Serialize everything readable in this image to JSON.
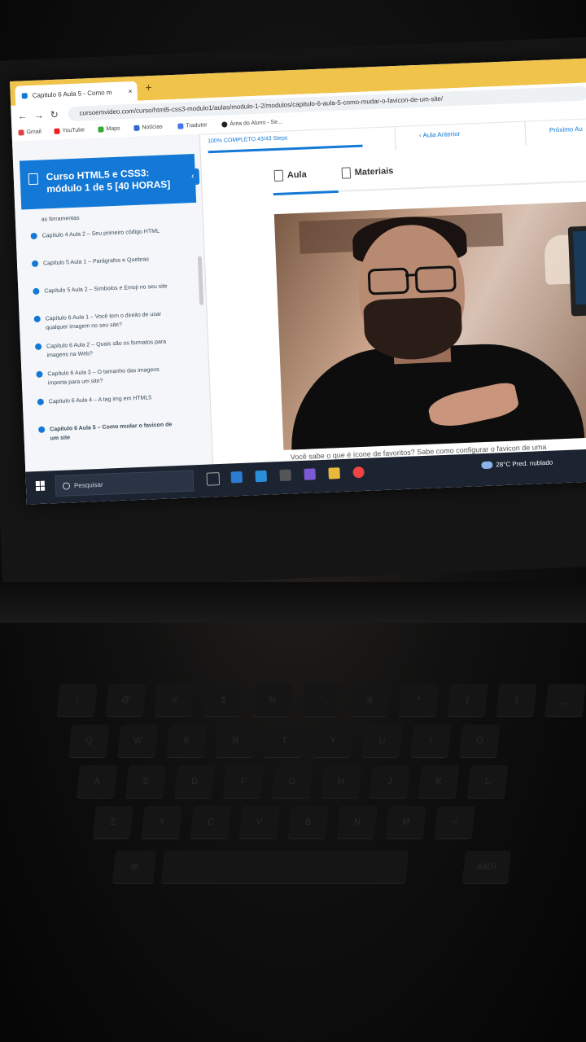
{
  "browser": {
    "tab_title": "Capitulo 6 Aula 5 - Como m",
    "url": "cursoemvideo.com/curso/html5-css3-modulo1/aulas/modulo-1-2/modulos/capitulo-6-aula-5-como-mudar-o-favicon-de-um-site/",
    "bookmarks": [
      "Gmail",
      "YouTube",
      "Maps",
      "Notícias",
      "Tradutor",
      "Área do Aluno - Se..."
    ]
  },
  "course": {
    "title": "Curso HTML5 e CSS3: módulo 1 de 5 [40 HORAS]",
    "progress_text": "100% COMPLETO 43/43 Steps",
    "prev_label": "Aula Anterior",
    "next_label": "Próximo Au",
    "lessons": [
      "as ferramentas",
      "Capítulo 4 Aula 2 – Seu primeiro código HTML",
      "Capítulo 5 Aula 1 – Parágrafos e Quebras",
      "Capítulo 5 Aula 2 – Símbolos e Emoji no seu site",
      "Capítulo 6 Aula 1 – Você tem o direito de usar qualquer imagem no seu site?",
      "Capítulo 6 Aula 2 – Quais são os formatos para imagens na Web?",
      "Capítulo 6 Aula 3 – O tamanho das imagens importa para um site?",
      "Capítulo 6 Aula 4 – A tag img em HTML5",
      "Capítulo 6 Aula 5 – Como mudar o favicon de um site"
    ]
  },
  "content": {
    "tab_aula": "Aula",
    "tab_materiais": "Materiais",
    "caption": "Você sabe o que é ícone de favoritos? Sabe como configurar o favicon de uma"
  },
  "taskbar": {
    "search_placeholder": "Pesquisar",
    "weather": "28°C Pred. nublado"
  },
  "keyboard": {
    "row1": [
      "!",
      "@",
      "#",
      "$",
      "%",
      "¨",
      "&",
      "*",
      "(",
      ")",
      "_"
    ],
    "row1_digits": [
      "1",
      "2",
      "3",
      "4",
      "5",
      "6",
      "7",
      "8",
      "9",
      "0"
    ],
    "row2": [
      "Q",
      "W",
      "E",
      "R",
      "T",
      "Y",
      "U",
      "I",
      "O"
    ],
    "row3": [
      "A",
      "S",
      "D",
      "F",
      "G",
      "H",
      "J",
      "K",
      "L"
    ],
    "row4": [
      "Z",
      "X",
      "C",
      "V",
      "B",
      "N",
      "M",
      "<"
    ],
    "altgr": "AltGr"
  },
  "colors": {
    "accent": "#1479d6",
    "tab_bar": "#f0c34a",
    "taskbar": "#1c2331"
  }
}
